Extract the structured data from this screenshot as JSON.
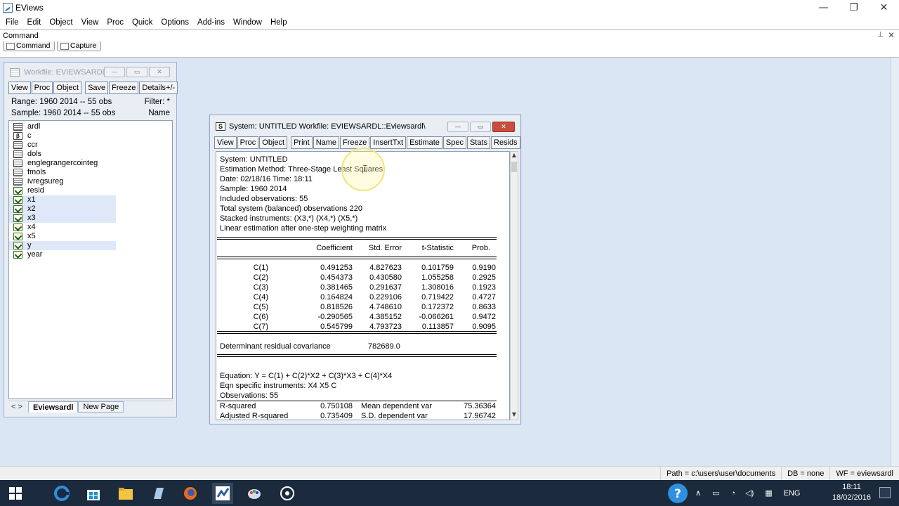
{
  "app": {
    "title": "EViews",
    "menu": [
      "File",
      "Edit",
      "Object",
      "View",
      "Proc",
      "Quick",
      "Options",
      "Add-ins",
      "Window",
      "Help"
    ],
    "controls": {
      "minimize": "—",
      "restore": "❐",
      "close": "✕"
    }
  },
  "command": {
    "header": "Command",
    "tabs": [
      "Command",
      "Capture"
    ]
  },
  "workfile": {
    "title": "Workfile: EVIEWSARDL...",
    "toolbar": [
      "View",
      "Proc",
      "Object",
      "Save",
      "Freeze",
      "Details+/-"
    ],
    "range_label": "Range:  1960 2014  --  55 obs",
    "filter_label": "Filter: *",
    "sample_label": "Sample: 1960 2014  --  55 obs",
    "order_label": "Name",
    "objects": [
      {
        "name": "ardl",
        "type": "equation",
        "selected": false
      },
      {
        "name": "c",
        "type": "coef",
        "selected": false
      },
      {
        "name": "ccr",
        "type": "equation",
        "selected": false
      },
      {
        "name": "dols",
        "type": "equation",
        "selected": false
      },
      {
        "name": "englegrangercointeg",
        "type": "equation",
        "selected": false
      },
      {
        "name": "fmols",
        "type": "equation",
        "selected": false
      },
      {
        "name": "ivregsureg",
        "type": "equation",
        "selected": false
      },
      {
        "name": "resid",
        "type": "series",
        "selected": false
      },
      {
        "name": "x1",
        "type": "series",
        "selected": true
      },
      {
        "name": "x2",
        "type": "series",
        "selected": true
      },
      {
        "name": "x3",
        "type": "series",
        "selected": true
      },
      {
        "name": "x4",
        "type": "series",
        "selected": false
      },
      {
        "name": "x5",
        "type": "series",
        "selected": false
      },
      {
        "name": "y",
        "type": "series",
        "selected": true
      },
      {
        "name": "year",
        "type": "series",
        "selected": false
      }
    ],
    "page_nav": "< >",
    "pages": [
      "Eviewsardl",
      "New Page"
    ]
  },
  "system": {
    "title": "System: UNTITLED   Workfile: EVIEWSARDL::Eviewsardl\\",
    "toolbar": [
      "View",
      "Proc",
      "Object",
      "Print",
      "Name",
      "Freeze",
      "InsertTxt",
      "Estimate",
      "Spec",
      "Stats",
      "Resids"
    ],
    "header_lines": [
      "System: UNTITLED",
      "Estimation Method: Three-Stage Least Squares",
      "Date: 02/18/16   Time: 18:11",
      "Sample: 1960 2014",
      "Included observations: 55",
      "Total system (balanced) observations 220",
      "Stacked instruments: (X3,*) (X4,*) (X5,*)",
      "Linear estimation after one-step weighting matrix"
    ],
    "columns": [
      "Coefficient",
      "Std. Error",
      "t-Statistic",
      "Prob."
    ],
    "rows": [
      {
        "name": "C(1)",
        "coef": "0.491253",
        "se": "4.827623",
        "t": "0.101759",
        "p": "0.9190"
      },
      {
        "name": "C(2)",
        "coef": "0.454373",
        "se": "0.430580",
        "t": "1.055258",
        "p": "0.2925"
      },
      {
        "name": "C(3)",
        "coef": "0.381465",
        "se": "0.291637",
        "t": "1.308016",
        "p": "0.1923"
      },
      {
        "name": "C(4)",
        "coef": "0.164824",
        "se": "0.229106",
        "t": "0.719422",
        "p": "0.4727"
      },
      {
        "name": "C(5)",
        "coef": "0.818526",
        "se": "4.748610",
        "t": "0.172372",
        "p": "0.8633"
      },
      {
        "name": "C(6)",
        "coef": "-0.290565",
        "se": "4.385152",
        "t": "-0.066261",
        "p": "0.9472"
      },
      {
        "name": "C(7)",
        "coef": "0.545799",
        "se": "4.793723",
        "t": "0.113857",
        "p": "0.9095"
      }
    ],
    "det_label": "Determinant residual covariance",
    "det_value": "782689.0",
    "equation_lines": [
      "Equation: Y = C(1) + C(2)*X2 + C(3)*X3 + C(4)*X4",
      "Eqn specific instruments: X4 X5 C",
      "Observations: 55"
    ],
    "stats": [
      {
        "label": "R-squared",
        "value": "0.750108",
        "label2": "Mean dependent var",
        "value2": "75.36364"
      },
      {
        "label": "Adjusted R-squared",
        "value": "0.735409",
        "label2": "S.D. dependent var",
        "value2": "17.96742"
      }
    ]
  },
  "status": {
    "path": "Path = c:\\users\\user\\documents",
    "db": "DB = none",
    "wf": "WF = eviewsardl"
  },
  "taskbar": {
    "lang": "ENG",
    "time": "18:11",
    "date": "18/02/2016"
  }
}
